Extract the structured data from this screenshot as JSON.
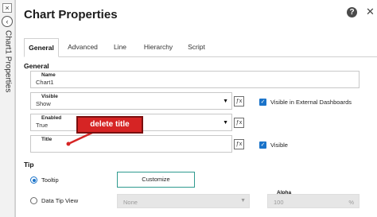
{
  "side_strip": {
    "close_glyph": "×",
    "back_glyph": "‹",
    "title": "Chart1 Properties"
  },
  "panel": {
    "title": "Chart Properties",
    "help_glyph": "?",
    "close_glyph": "✕"
  },
  "tabs": [
    {
      "label": "General",
      "active": true
    },
    {
      "label": "Advanced",
      "active": false
    },
    {
      "label": "Line",
      "active": false
    },
    {
      "label": "Hierarchy",
      "active": false
    },
    {
      "label": "Script",
      "active": false
    }
  ],
  "general": {
    "section_label": "General",
    "name": {
      "label": "Name",
      "value": "Chart1"
    },
    "visible": {
      "label": "Visible",
      "value": "Show"
    },
    "visible_external": {
      "label": "Visible in External Dashboards",
      "checked": true
    },
    "enabled": {
      "label": "Enabled",
      "value": "True"
    },
    "title": {
      "label": "Title",
      "value": ""
    },
    "title_visible": {
      "label": "Visible",
      "checked": true
    },
    "fx_glyph": "ƒx"
  },
  "tip": {
    "section_label": "Tip",
    "tooltip_label": "Tooltip",
    "tooltip_selected": true,
    "customize_label": "Customize",
    "data_tip_label": "Data Tip View",
    "data_tip_selected": false,
    "data_tip_value": "None",
    "alpha_label": "Alpha",
    "alpha_value": "100",
    "alpha_unit": "%"
  },
  "annotation": {
    "text": "delete title",
    "color": "#d62424"
  },
  "colors": {
    "accent": "#1a73c9",
    "button_border": "#2f9a8f"
  }
}
